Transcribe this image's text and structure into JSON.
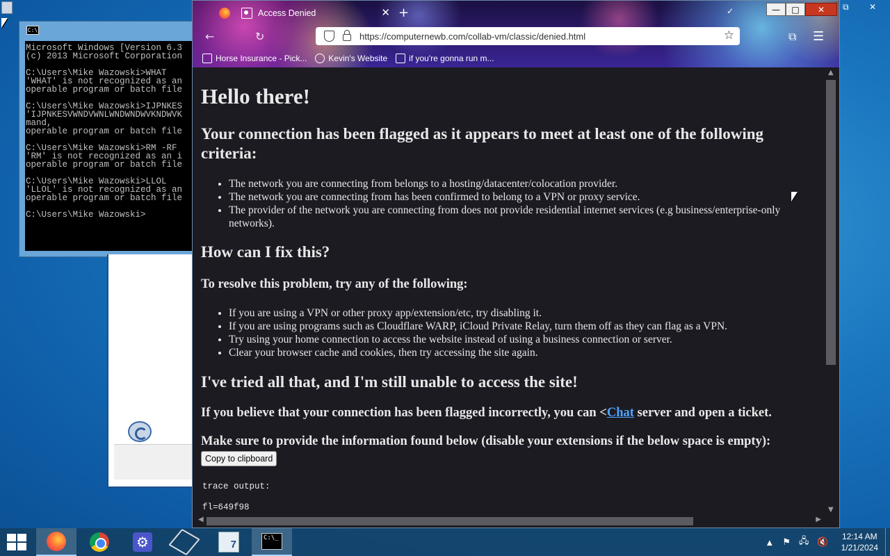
{
  "cmd": {
    "lines": [
      "Microsoft Windows [Version 6.3",
      "(c) 2013 Microsoft Corporation",
      "",
      "C:\\Users\\Mike Wazowski>WHAT",
      "'WHAT' is not recognized as an",
      "operable program or batch file",
      "",
      "C:\\Users\\Mike Wazowski>IJPNKES",
      "'IJPNKESVWNDVWNLWNDWNDWVKNDWVK",
      "mand,",
      "operable program or batch file",
      "",
      "C:\\Users\\Mike Wazowski>RM -RF",
      "'RM' is not recognized as an i",
      "operable program or batch file",
      "",
      "C:\\Users\\Mike Wazowski>LLOL",
      "'LLOL' is not recognized as an",
      "operable program or batch file",
      "",
      "C:\\Users\\Mike Wazowski>"
    ]
  },
  "browser": {
    "tab_title": "Access Denied",
    "url": "https://computernewb.com/collab-vm/classic/denied.html",
    "bookmarks": [
      {
        "label": "Horse Insurance - Pick..."
      },
      {
        "label": "Kevin's Website"
      },
      {
        "label": "if you're gonna run m..."
      }
    ]
  },
  "page": {
    "heading": "Hello there!",
    "flag_heading": "Your connection has been flagged as it appears to meet at least one of the following criteria:",
    "criteria": [
      "The network you are connecting from belongs to a hosting/datacenter/colocation provider.",
      "The network you are connecting from has been confirmed to belong to a VPN or proxy service.",
      "The provider of the network you are connecting from does not provide residential internet services (e.g business/enterprise-only networks)."
    ],
    "fix_heading": "How can I fix this?",
    "resolve_text": "To resolve this problem, try any of the following:",
    "fixes": [
      "If you are using a VPN or other proxy app/extension/etc, try disabling it.",
      "If you are using programs such as Cloudflare WARP, iCloud Private Relay, turn them off as they can flag as a VPN.",
      "Try using your home connection to access the website instead of using a business connection or server.",
      "Clear your browser cache and cookies, then try accessing the site again."
    ],
    "tried_heading": "I've tried all that, and I'm still unable to access the site!",
    "incorrect_pre": "If you believe that your connection has been flagged incorrectly, you can <",
    "chat_link": "Chat",
    "incorrect_post": " server and open a ticket.",
    "info_text": "Make sure to provide the information found below (disable your extensions if the below space is empty):",
    "copy_button": "Copy to clipboard",
    "trace_label": "trace output:",
    "trace_line": "fl=649f98"
  },
  "taskbar": {
    "time": "12:14 AM",
    "date": "1/21/2024",
    "w7_label": "7"
  }
}
